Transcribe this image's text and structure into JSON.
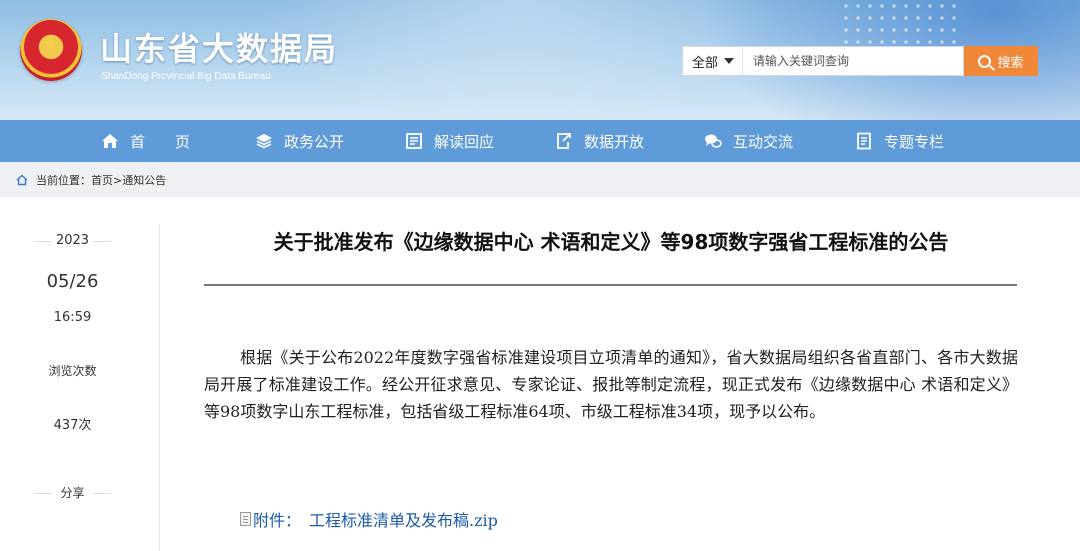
{
  "header": {
    "site_title": "山东省大数据局",
    "site_subtitle": "ShanDong Provincial Big Data Bureau",
    "search": {
      "scope": "全部",
      "placeholder": "请输入关键词查询",
      "button_label": "搜索"
    }
  },
  "nav": {
    "items": [
      {
        "label": "首　　页",
        "icon": "home-icon"
      },
      {
        "label": "政务公开",
        "icon": "layers-icon"
      },
      {
        "label": "解读回应",
        "icon": "document-icon"
      },
      {
        "label": "数据开放",
        "icon": "export-icon"
      },
      {
        "label": "互动交流",
        "icon": "chat-icon"
      },
      {
        "label": "专题专栏",
        "icon": "list-icon"
      }
    ]
  },
  "breadcrumb": {
    "prefix": "当前位置：",
    "path": "首页>通知公告"
  },
  "meta": {
    "year": "2023",
    "date": "05/26",
    "time": "16:59",
    "views_label": "浏览次数",
    "views": "437次",
    "share_label": "分享"
  },
  "article": {
    "title": "关于批准发布《边缘数据中心 术语和定义》等98项数字强省工程标准的公告",
    "body": "根据《关于公布2022年度数字强省标准建设项目立项清单的通知》，省大数据局组织各省直部门、各市大数据局开展了标准建设工作。经公开征求意见、专家论证、报批等制定流程，现正式发布《边缘数据中心 术语和定义》等98项数字山东工程标准，包括省级工程标准64项、市级工程标准34项，现予以公布。",
    "attachment_prefix": "附件：",
    "attachment_name": "工程标准清单及发布稿.zip"
  },
  "colors": {
    "nav_bg": "#5e9bd8",
    "search_button": "#f0883a",
    "link": "#1d5aa8"
  }
}
